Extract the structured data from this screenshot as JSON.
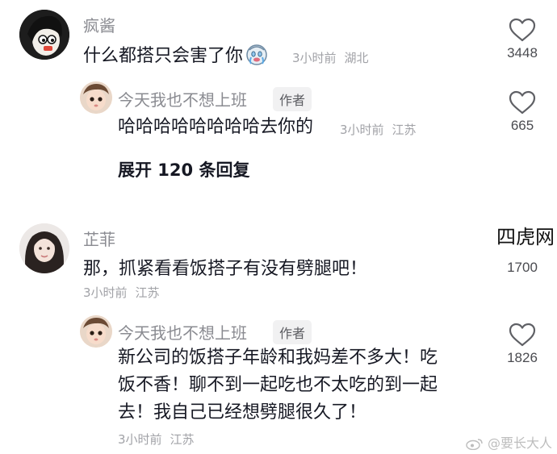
{
  "comments": [
    {
      "username": "疯酱",
      "text": "什么都搭只会害了你",
      "time": "3小时前",
      "location": "湖北",
      "likes": "3448",
      "reply": {
        "username": "今天我也不想上班",
        "badge": "作者",
        "text": "哈哈哈哈哈哈哈哈去你的",
        "time": "3小时前",
        "location": "江苏",
        "likes": "665"
      },
      "expand_label": "展开 120 条回复"
    },
    {
      "username": "芷菲",
      "text": "那，抓紧看看饭搭子有没有劈腿吧！",
      "time": "3小时前",
      "location": "江苏",
      "likes": "1700",
      "reply": {
        "username": "今天我也不想上班",
        "badge": "作者",
        "text_lines": [
          "新公司的饭搭子年龄和我妈差不多大！吃",
          "饭不香！聊不到一起吃也不太吃的到一起",
          "去！我自己已经想劈腿很久了！"
        ],
        "time": "3小时前",
        "location": "江苏",
        "likes": "1826"
      }
    }
  ],
  "watermarks": {
    "site": "四虎网",
    "weibo": "@要长大人"
  },
  "icons": {
    "like": "heart-outline-icon",
    "emoji": "crying-face-icon",
    "weibo": "weibo-logo-icon"
  },
  "colors": {
    "text": "#161823",
    "secondary": "#8a8b91",
    "meta": "#a1a2a7",
    "badge_bg": "#f1f1f2"
  }
}
